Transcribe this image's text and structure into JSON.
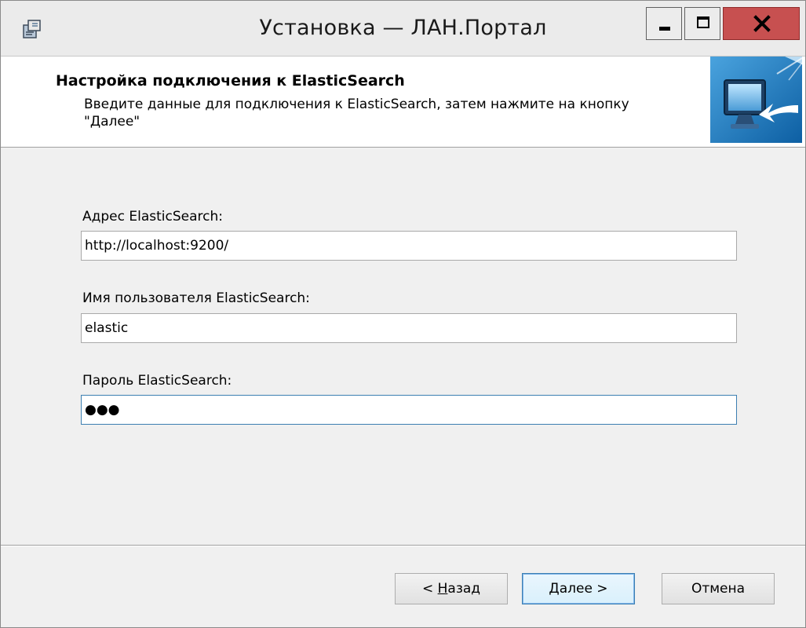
{
  "window": {
    "title": "Установка — ЛАН.Портал",
    "close_glyph": "x"
  },
  "banner": {
    "title": "Настройка подключения к ElasticSearch",
    "description": "Введите данные для подключения к ElasticSearch, затем нажмите на кнопку \"Далее\""
  },
  "fields": {
    "address": {
      "label": "Адрес ElasticSearch:",
      "value": "http://localhost:9200/"
    },
    "username": {
      "label": "Имя пользователя ElasticSearch:",
      "value": "elastic"
    },
    "password": {
      "label": "Пароль ElasticSearch:",
      "value": "●●●"
    }
  },
  "buttons": {
    "back": {
      "mnemonic": "Н",
      "rest": "азад",
      "prefix": "< "
    },
    "next": {
      "mnemonic": "Д",
      "rest": "алее",
      "suffix": " >"
    },
    "cancel": {
      "label": "Отмена"
    }
  },
  "colors": {
    "focus_border": "#3c7fb1",
    "close_button": "#c75050"
  }
}
